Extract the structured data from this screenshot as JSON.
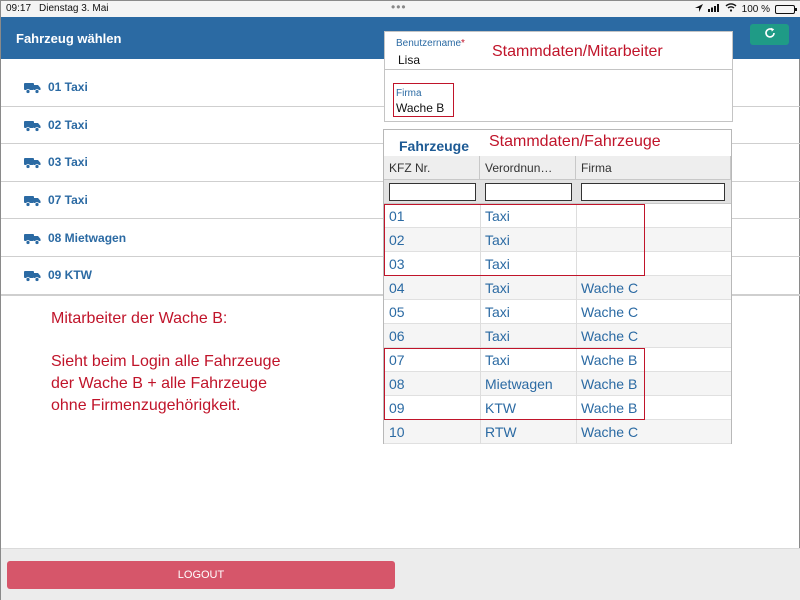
{
  "status": {
    "time": "09:17",
    "date": "Dienstag 3. Mai",
    "battery": "100 %",
    "battery_level": 1.0
  },
  "header": {
    "title": "Fahrzeug wählen",
    "refresh_icon": "refresh-icon"
  },
  "vehicles": [
    {
      "label": "01 Taxi"
    },
    {
      "label": "02 Taxi"
    },
    {
      "label": "03 Taxi"
    },
    {
      "label": "07 Taxi"
    },
    {
      "label": "08 Mietwagen"
    },
    {
      "label": "09 KTW"
    }
  ],
  "user_panel": {
    "username_label": "Benutzername",
    "username_required": "*",
    "username_value": "Lisa",
    "annotation": "Stammdaten/Mitarbeiter",
    "firma_label": "Firma",
    "firma_value": "Wache B"
  },
  "table": {
    "title": "Fahrzeuge",
    "annotation": "Stammdaten/Fahrzeuge",
    "columns": [
      "KFZ Nr.",
      "Verordnun…",
      "Firma"
    ],
    "rows": [
      {
        "kfz": "01",
        "typ": "Taxi",
        "firma": ""
      },
      {
        "kfz": "02",
        "typ": "Taxi",
        "firma": ""
      },
      {
        "kfz": "03",
        "typ": "Taxi",
        "firma": ""
      },
      {
        "kfz": "04",
        "typ": "Taxi",
        "firma": "Wache C"
      },
      {
        "kfz": "05",
        "typ": "Taxi",
        "firma": "Wache C"
      },
      {
        "kfz": "06",
        "typ": "Taxi",
        "firma": "Wache C"
      },
      {
        "kfz": "07",
        "typ": "Taxi",
        "firma": "Wache B"
      },
      {
        "kfz": "08",
        "typ": "Mietwagen",
        "firma": "Wache B"
      },
      {
        "kfz": "09",
        "typ": "KTW",
        "firma": "Wache B"
      },
      {
        "kfz": "10",
        "typ": "RTW",
        "firma": "Wache C"
      }
    ]
  },
  "note": {
    "line1": "Mitarbeiter der Wache B:",
    "line2": "Sieht beim Login alle Fahrzeuge",
    "line3": "der Wache B + alle Fahrzeuge",
    "line4": "ohne Firmenzugehörigkeit."
  },
  "logout": {
    "label": "LOGOUT"
  },
  "colors": {
    "header": "#2b6aa3",
    "accent": "#1f9b86",
    "annotation": "#c0142a",
    "logout": "#d6566a"
  }
}
